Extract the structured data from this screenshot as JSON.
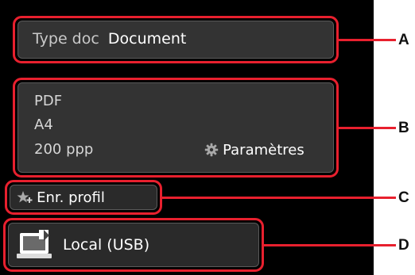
{
  "doc_type": {
    "key": "Type doc",
    "value": "Document"
  },
  "scan_settings": {
    "format": "PDF",
    "paper_size": "A4",
    "resolution": "200 ppp",
    "settings_label": "Paramètres"
  },
  "save_profile": {
    "label": "Enr. profil"
  },
  "destination": {
    "label": "Local (USB)"
  },
  "callouts": [
    "A",
    "B",
    "C",
    "D"
  ],
  "colors": {
    "highlight": "#e8202e",
    "panel": "#333333",
    "background": "#000000"
  },
  "icons": [
    "gear-icon",
    "star-plus-icon",
    "computer-usb-icon"
  ]
}
